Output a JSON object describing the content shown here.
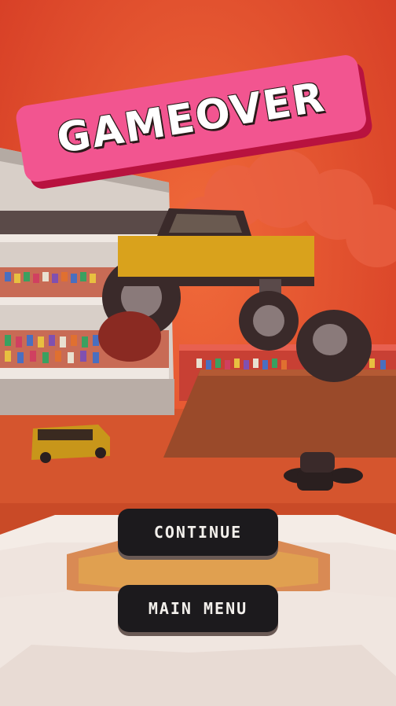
{
  "banner": {
    "title": "GAMEOVER"
  },
  "buttons": {
    "continue": "CONTINUE",
    "main_menu": "MAIN MENU"
  },
  "colors": {
    "sky": "#e24a2c",
    "banner": "#f25590",
    "button": "#1c1a1d",
    "truck_body": "#d9a21c"
  }
}
